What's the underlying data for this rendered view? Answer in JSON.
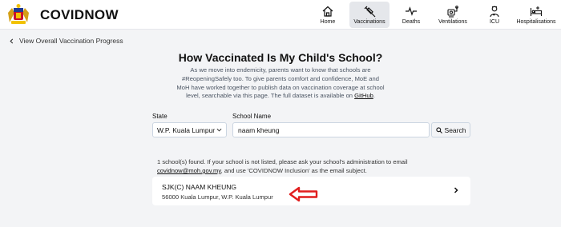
{
  "brand": {
    "name": "COVIDNOW",
    "logo_icon": "malaysia-coat-of-arms-icon"
  },
  "nav": [
    {
      "label": "Home",
      "icon": "home-icon",
      "active": false
    },
    {
      "label": "Vaccinations",
      "icon": "syringe-icon",
      "active": true
    },
    {
      "label": "Deaths",
      "icon": "heartbeat-icon",
      "active": false
    },
    {
      "label": "Ventilations",
      "icon": "ventilator-icon",
      "active": false
    },
    {
      "label": "ICU",
      "icon": "icu-doctor-icon",
      "active": false
    },
    {
      "label": "Hospitalisations",
      "icon": "hospital-bed-icon",
      "active": false
    }
  ],
  "back_link": "View Overall Vaccination Progress",
  "title": "How Vaccinated Is My Child's School?",
  "description": {
    "text": "As we move into endemicity, parents want to know that schools are #ReopeningSafely too. To give parents comfort and confidence, MoE and MoH have worked together to publish data on vaccination coverage at school level, searchable via this page. The full dataset is available on ",
    "link": "GitHub",
    "end": "."
  },
  "form": {
    "state_label": "State",
    "state_value": "W.P. Kuala Lumpur",
    "school_label": "School Name",
    "school_value": "naam kheung",
    "search_label": "Search"
  },
  "results": {
    "note_before": "1 school(s) found. If your school is not listed, please ask your school's administration to email ",
    "email": "covidnow@moh.gov.my",
    "note_after": ", and use 'COVIDNOW Inclusion' as the email subject.",
    "items": [
      {
        "name": "SJK(C) NAAM KHEUNG",
        "address": "56000 Kuala Lumpur, W.P. Kuala Lumpur"
      }
    ]
  },
  "annotation": {
    "arrow_color": "#e11d1d"
  },
  "colors": {
    "accent_bg": "#e5e7eb",
    "page_bg": "#f3f4f6"
  }
}
